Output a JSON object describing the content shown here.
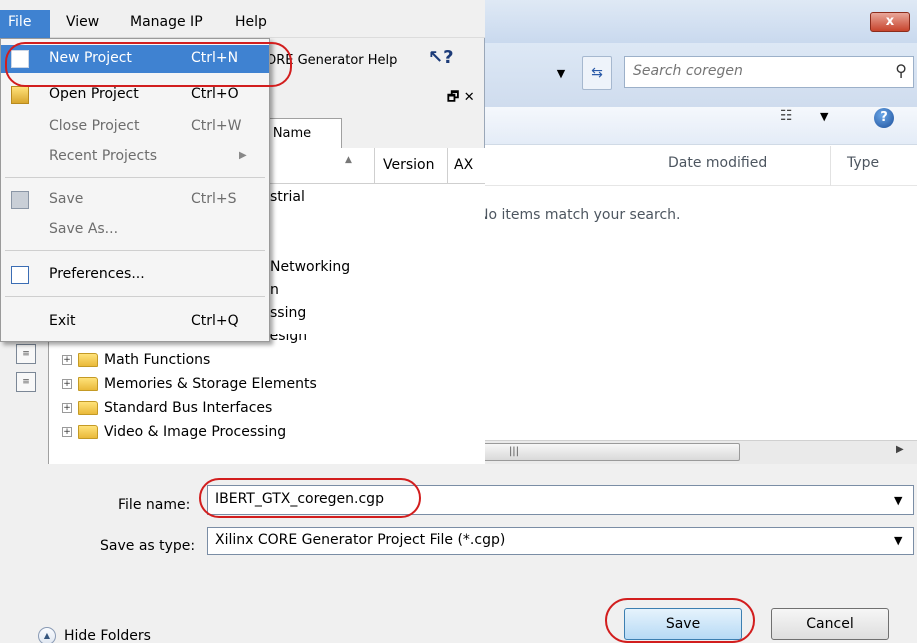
{
  "menubar": {
    "file": "File",
    "view": "View",
    "manage_ip": "Manage IP",
    "help": "Help"
  },
  "file_menu": {
    "new_project": {
      "label": "New Project",
      "shortcut": "Ctrl+N"
    },
    "open_project": {
      "label": "Open Project",
      "shortcut": "Ctrl+O"
    },
    "close_project": {
      "label": "Close Project",
      "shortcut": "Ctrl+W"
    },
    "recent_projects": {
      "label": "Recent Projects"
    },
    "save": {
      "label": "Save",
      "shortcut": "Ctrl+S"
    },
    "save_as": {
      "label": "Save As..."
    },
    "preferences": {
      "label": "Preferences..."
    },
    "exit": {
      "label": "Exit",
      "shortcut": "Ctrl+Q"
    }
  },
  "coregen": {
    "help_button": "ORE Generator Help",
    "tab_label": "y Name",
    "tree_header": {
      "version": "Version",
      "ax": "AX"
    },
    "tree_fragments": [
      "strial",
      "Networking",
      "n",
      "ssing",
      "FPGA Features and Design"
    ],
    "tree_items": [
      "Math Functions",
      "Memories & Storage Elements",
      "Standard Bus Interfaces",
      "Video & Image Processing"
    ]
  },
  "dialog": {
    "close_label": "x",
    "search_placeholder": "Search coregen",
    "columns": {
      "date_modified": "Date modified",
      "type": "Type"
    },
    "empty_message": "No items match your search.",
    "file_name_label": "File name:",
    "file_name_value": "IBERT_GTX_coregen.cgp",
    "save_as_type_label": "Save as type:",
    "save_as_type_value": "Xilinx CORE Generator Project File (*.cgp)",
    "hide_folders_label": "Hide Folders",
    "save_button": "Save",
    "cancel_button": "Cancel"
  },
  "colors": {
    "highlight": "#d21e1e",
    "menu_selection": "#3f82d1"
  }
}
